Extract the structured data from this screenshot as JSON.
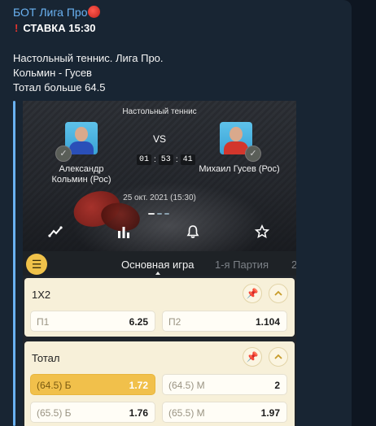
{
  "message": {
    "sender": "БОТ Лига Про",
    "sender_emoji": "table-tennis-icon",
    "stake_line": "СТАВКА 15:30",
    "line1": "Настольный теннис. Лига Про.",
    "line2": "Кольмин - Гусев",
    "line3": "Тотал больше 64.5"
  },
  "match": {
    "sport": "Настольный теннис",
    "player1": "Александр\nКольмин (Рос)",
    "player2": "Михаил Гусев (Рос)",
    "vs": "VS",
    "timer": [
      "01",
      "53",
      "41"
    ],
    "date": "25 окт. 2021 (15:30)"
  },
  "tabs": {
    "main": "Основная игра",
    "set1": "1-я Партия",
    "set2": "2"
  },
  "markets": {
    "m1x2": {
      "title": "1X2",
      "p1_label": "П1",
      "p1_value": "6.25",
      "p2_label": "П2",
      "p2_value": "1.104"
    },
    "total": {
      "title": "Тотал",
      "r1_left_label": "(64.5) Б",
      "r1_left_value": "1.72",
      "r1_right_label": "(64.5) М",
      "r1_right_value": "2",
      "r2_left_label": "(65.5) Б",
      "r2_left_value": "1.76",
      "r2_right_label": "(65.5) М",
      "r2_right_value": "1.97"
    }
  },
  "colors": {
    "chat_bg": "#0e1621",
    "bubble_bg": "#182533",
    "accent": "#6ab2f2",
    "selected_odd": "#f1c04b",
    "market_bg": "#f7f0d9"
  }
}
